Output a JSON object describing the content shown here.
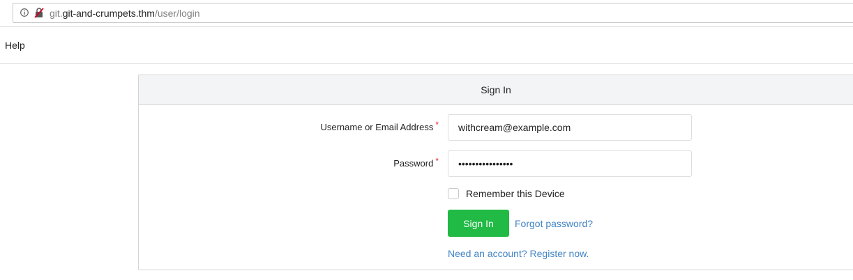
{
  "browser": {
    "url_prefix": "git.",
    "url_host": "git-and-crumpets.thm",
    "url_path": "/user/login"
  },
  "nav": {
    "help_label": "Help"
  },
  "signin": {
    "title": "Sign In",
    "username_label": "Username or Email Address",
    "username_value": "withcream@example.com",
    "password_label": "Password",
    "password_value": "••••••••••••••••",
    "required_marker": "*",
    "remember_label": "Remember this Device",
    "remember_checked": false,
    "submit_label": "Sign In",
    "forgot_label": "Forgot password?",
    "register_label": "Need an account? Register now."
  },
  "colors": {
    "primary_button": "#21ba45",
    "link": "#4183c4",
    "required": "#db2828"
  }
}
